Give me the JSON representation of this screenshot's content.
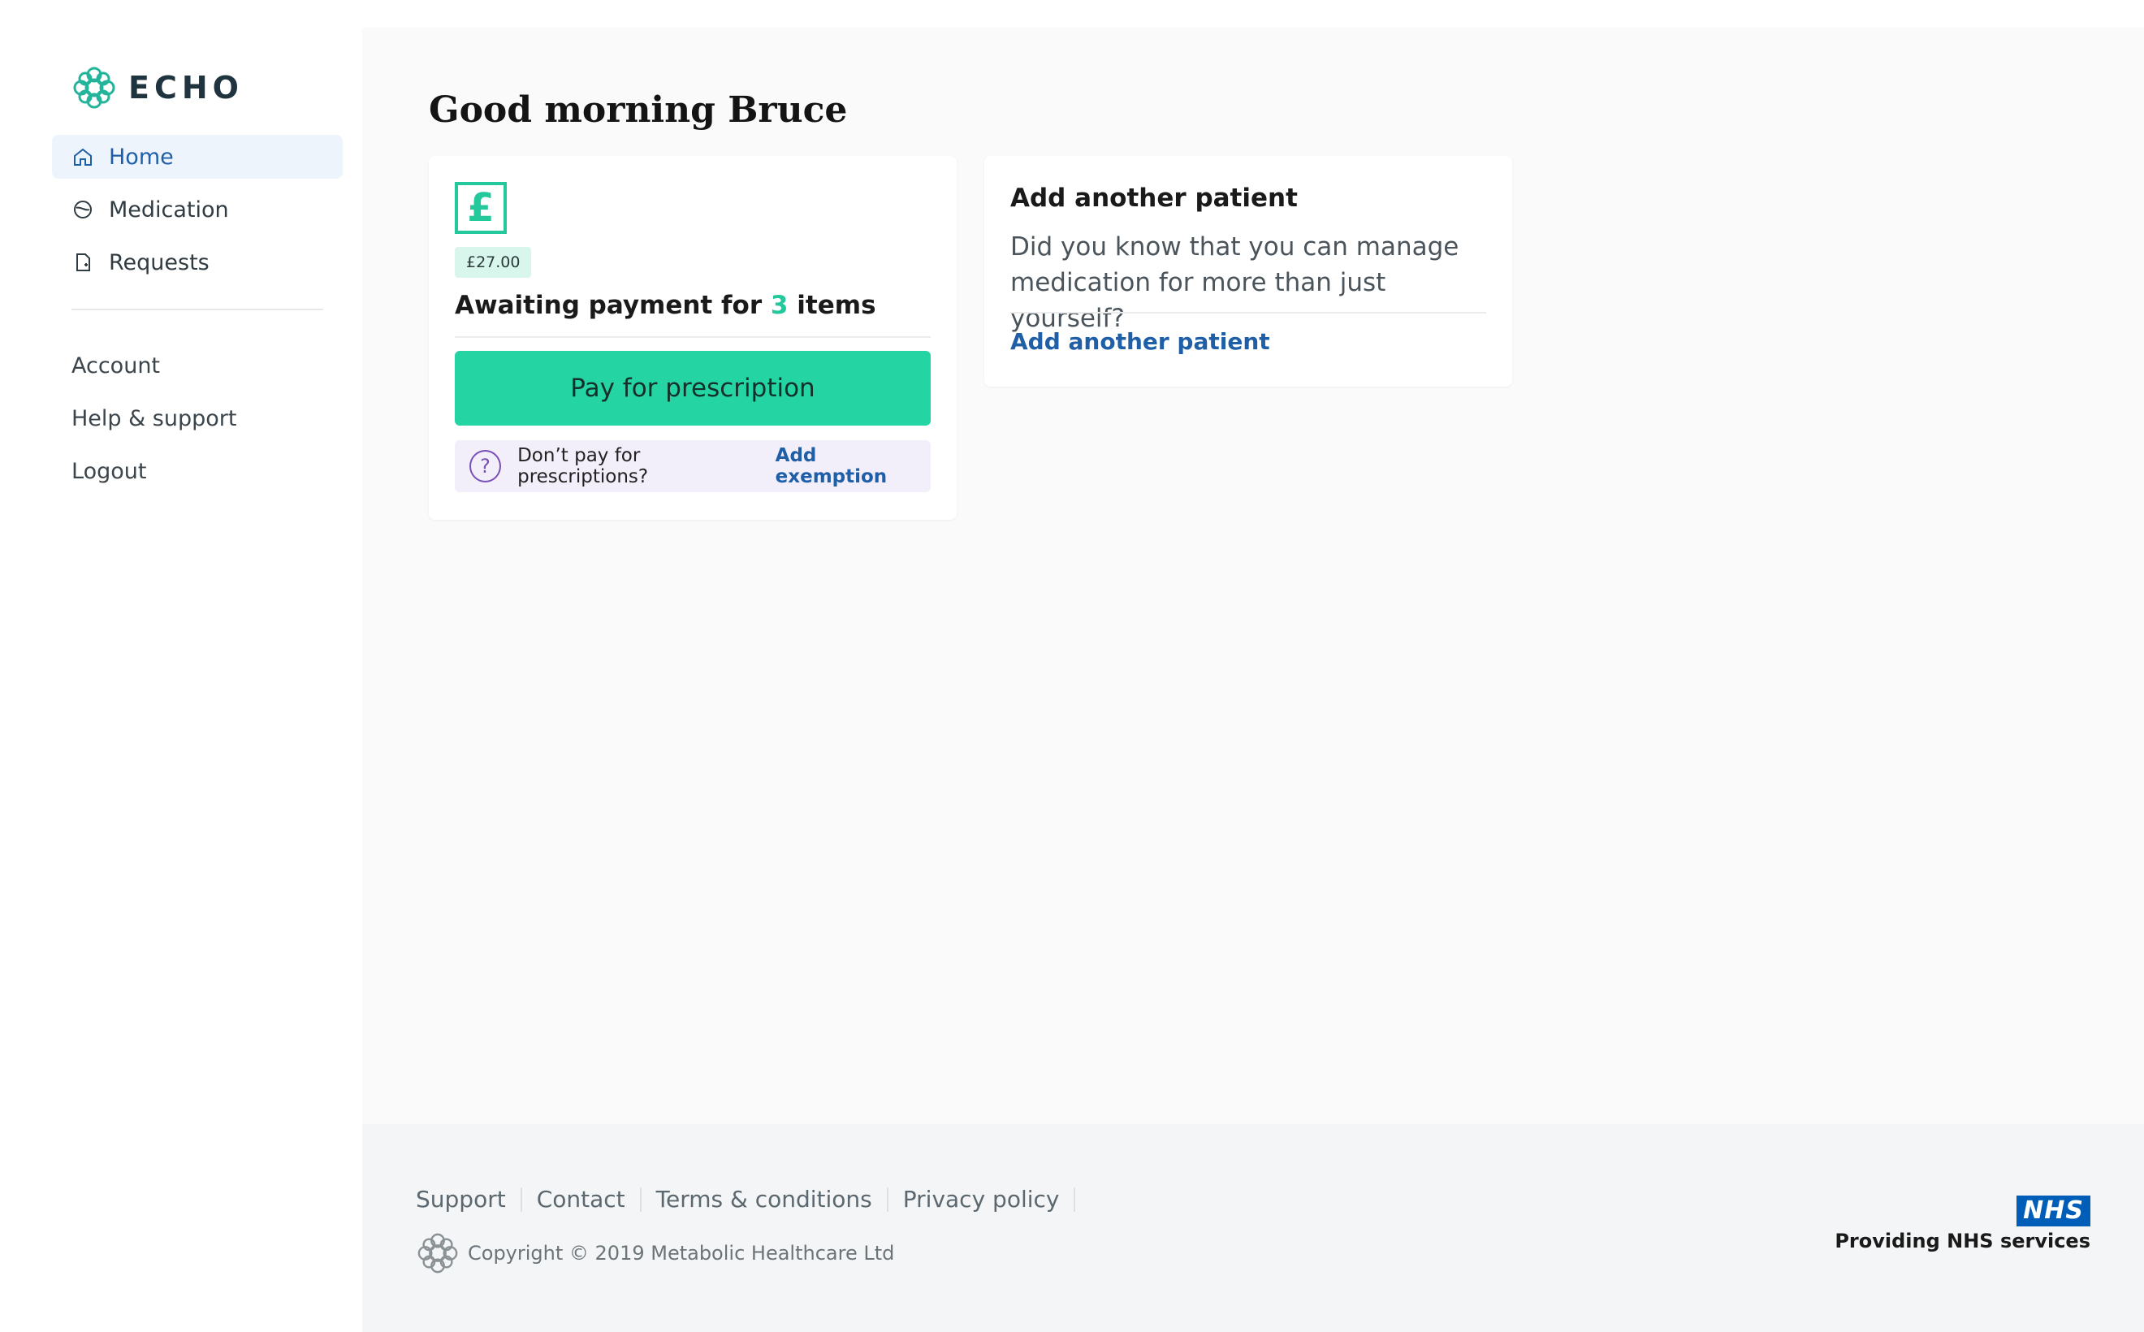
{
  "brand": {
    "name": "ECHO",
    "accent": "#23c99b"
  },
  "sidebar": {
    "items": [
      {
        "label": "Home",
        "icon": "home-icon",
        "active": true
      },
      {
        "label": "Medication",
        "icon": "pill-icon",
        "active": false
      },
      {
        "label": "Requests",
        "icon": "document-icon",
        "active": false
      }
    ],
    "secondary": [
      {
        "label": "Account"
      },
      {
        "label": "Help & support"
      },
      {
        "label": "Logout"
      }
    ]
  },
  "main": {
    "greeting": "Good morning Bruce",
    "payment_card": {
      "icon": "pound-icon",
      "currency_symbol": "£",
      "amount": "£27.00",
      "awaiting_prefix": "Awaiting payment for",
      "item_count": "3",
      "awaiting_suffix": "items",
      "pay_button": "Pay for prescription",
      "exemption_question": "Don’t pay for prescriptions?",
      "exemption_link": "Add exemption"
    },
    "patient_card": {
      "title": "Add another patient",
      "description": "Did you know that you can manage medication for more than just yourself?",
      "link": "Add another patient"
    }
  },
  "footer": {
    "links": [
      "Support",
      "Contact",
      "Terms & conditions",
      "Privacy policy"
    ],
    "copyright": "Copyright © 2019 Metabolic Healthcare Ltd",
    "nhs_logo": "NHS",
    "nhs_text": "Providing NHS services"
  }
}
